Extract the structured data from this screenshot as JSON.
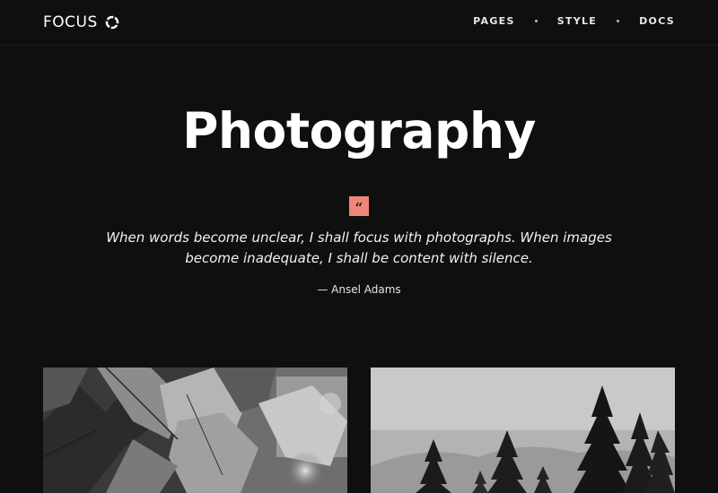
{
  "header": {
    "logo_text": "FOCUS",
    "logo_icon": "ring-icon",
    "nav": [
      {
        "label": "PAGES"
      },
      {
        "label": "STYLE"
      },
      {
        "label": "DOCS"
      }
    ]
  },
  "hero": {
    "title": "Photography",
    "quote_mark": "“",
    "quote": "When words become unclear, I shall focus with photographs. When images become inadequate, I shall be content with silence.",
    "attribution": "— Ansel Adams"
  },
  "gallery": {
    "photos": [
      {
        "subject": "leaves"
      },
      {
        "subject": "pine-trees"
      }
    ]
  },
  "colors": {
    "background": "#0f0f10",
    "accent": "#f0857a",
    "text": "#ffffff"
  }
}
